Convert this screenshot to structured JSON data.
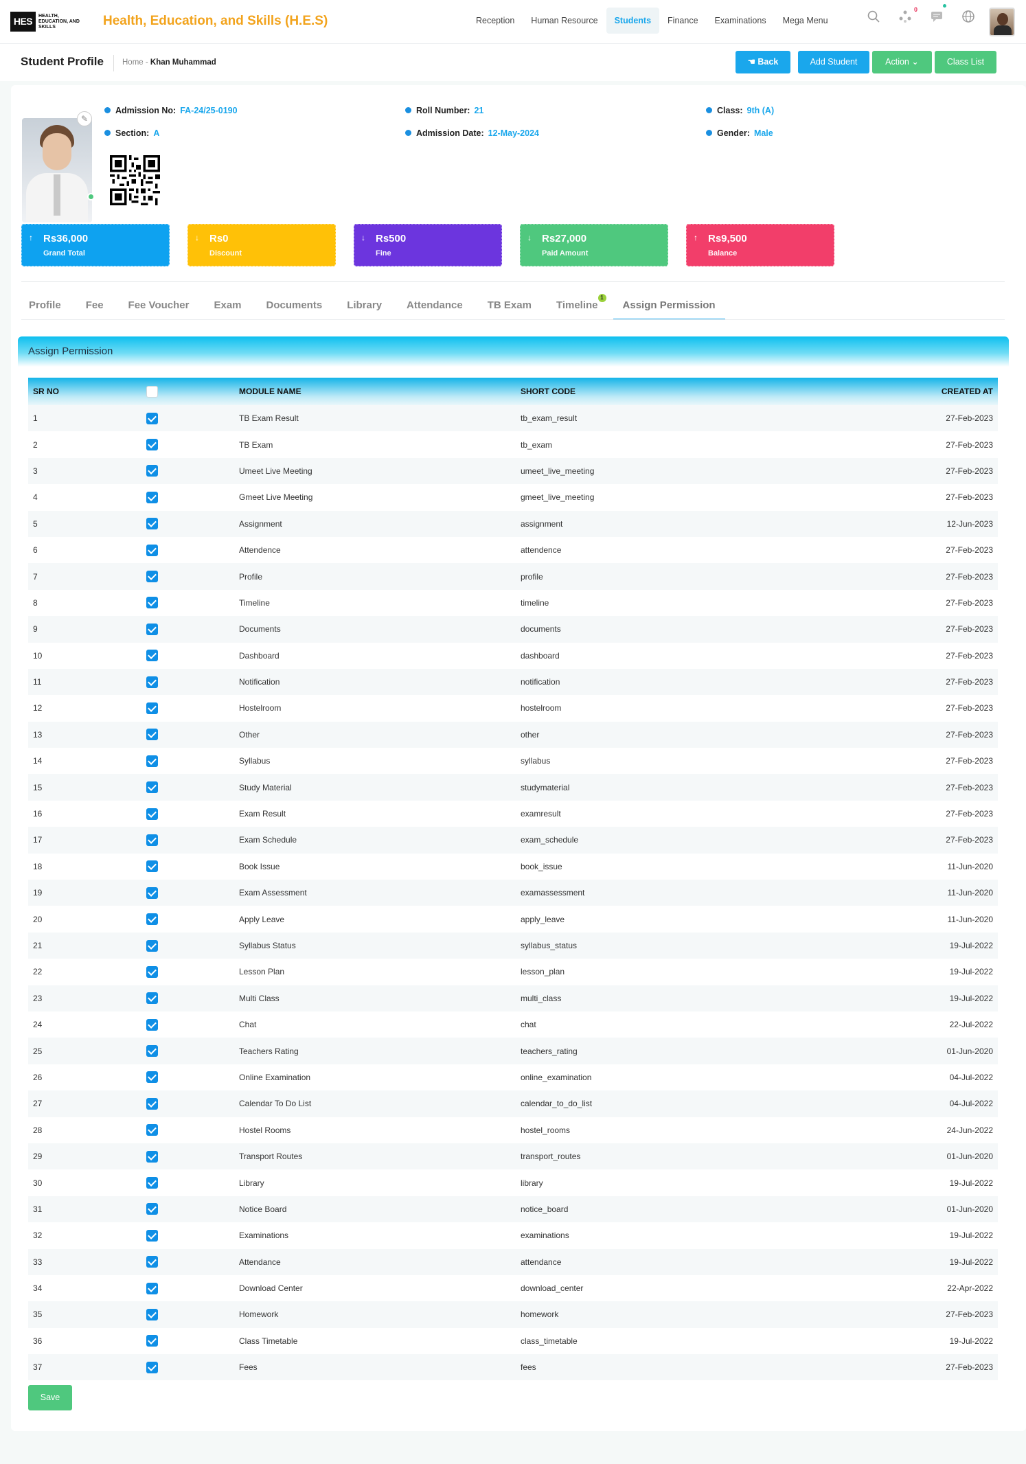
{
  "header": {
    "logo_text": "HES",
    "logo_sub": "HEALTH, EDUCATION, AND SKILLS",
    "brand": "Health, Education, and Skills (H.E.S)",
    "nav": [
      "Reception",
      "Human Resource",
      "Students",
      "Finance",
      "Examinations",
      "Mega Menu"
    ],
    "active_nav": "Students",
    "notification_count": "0",
    "icons": [
      "search-icon",
      "network-icon",
      "chat-icon",
      "globe-icon"
    ]
  },
  "subheader": {
    "title": "Student Profile",
    "breadcrumb_home": "Home",
    "breadcrumb_current": "Khan Muhammad",
    "back_label": "Back",
    "add_student_label": "Add Student",
    "action_label": "Action",
    "class_list_label": "Class List"
  },
  "student": {
    "admission_no_label": "Admission No:",
    "admission_no": "FA-24/25-0190",
    "roll_label": "Roll Number:",
    "roll": "21",
    "class_label": "Class:",
    "class": "9th (A)",
    "section_label": "Section:",
    "section": "A",
    "admission_date_label": "Admission Date:",
    "admission_date": "12-May-2024",
    "gender_label": "Gender:",
    "gender": "Male"
  },
  "stats": [
    {
      "amount": "Rs36,000",
      "label": "Grand Total",
      "color": "#0ea2f0",
      "arrow": "up"
    },
    {
      "amount": "Rs0",
      "label": "Discount",
      "color": "#ffc107",
      "arrow": "down"
    },
    {
      "amount": "Rs500",
      "label": "Fine",
      "color": "#6c35de",
      "arrow": "down"
    },
    {
      "amount": "Rs27,000",
      "label": "Paid Amount",
      "color": "#4fc87e",
      "arrow": "down"
    },
    {
      "amount": "Rs9,500",
      "label": "Balance",
      "color": "#f23e6a",
      "arrow": "up"
    }
  ],
  "tabs": [
    "Profile",
    "Fee",
    "Fee Voucher",
    "Exam",
    "Documents",
    "Library",
    "Attendance",
    "TB Exam",
    "Timeline",
    "Assign Permission"
  ],
  "timeline_badge": "1",
  "active_tab": "Assign Permission",
  "panel": {
    "title": "Assign Permission",
    "save_label": "Save",
    "headers": [
      "SR NO",
      "",
      "MODULE NAME",
      "SHORT CODE",
      "CREATED AT"
    ]
  },
  "rows": [
    [
      "1",
      "TB Exam Result",
      "tb_exam_result",
      "27-Feb-2023"
    ],
    [
      "2",
      "TB Exam",
      "tb_exam",
      "27-Feb-2023"
    ],
    [
      "3",
      "Umeet Live Meeting",
      "umeet_live_meeting",
      "27-Feb-2023"
    ],
    [
      "4",
      "Gmeet Live Meeting",
      "gmeet_live_meeting",
      "27-Feb-2023"
    ],
    [
      "5",
      "Assignment",
      "assignment",
      "12-Jun-2023"
    ],
    [
      "6",
      "Attendence",
      "attendence",
      "27-Feb-2023"
    ],
    [
      "7",
      "Profile",
      "profile",
      "27-Feb-2023"
    ],
    [
      "8",
      "Timeline",
      "timeline",
      "27-Feb-2023"
    ],
    [
      "9",
      "Documents",
      "documents",
      "27-Feb-2023"
    ],
    [
      "10",
      "Dashboard",
      "dashboard",
      "27-Feb-2023"
    ],
    [
      "11",
      "Notification",
      "notification",
      "27-Feb-2023"
    ],
    [
      "12",
      "Hostelroom",
      "hostelroom",
      "27-Feb-2023"
    ],
    [
      "13",
      "Other",
      "other",
      "27-Feb-2023"
    ],
    [
      "14",
      "Syllabus",
      "syllabus",
      "27-Feb-2023"
    ],
    [
      "15",
      "Study Material",
      "studymaterial",
      "27-Feb-2023"
    ],
    [
      "16",
      "Exam Result",
      "examresult",
      "27-Feb-2023"
    ],
    [
      "17",
      "Exam Schedule",
      "exam_schedule",
      "27-Feb-2023"
    ],
    [
      "18",
      "Book Issue",
      "book_issue",
      "11-Jun-2020"
    ],
    [
      "19",
      "Exam Assessment",
      "examassessment",
      "11-Jun-2020"
    ],
    [
      "20",
      "Apply Leave",
      "apply_leave",
      "11-Jun-2020"
    ],
    [
      "21",
      "Syllabus Status",
      "syllabus_status",
      "19-Jul-2022"
    ],
    [
      "22",
      "Lesson Plan",
      "lesson_plan",
      "19-Jul-2022"
    ],
    [
      "23",
      "Multi Class",
      "multi_class",
      "19-Jul-2022"
    ],
    [
      "24",
      "Chat",
      "chat",
      "22-Jul-2022"
    ],
    [
      "25",
      "Teachers Rating",
      "teachers_rating",
      "01-Jun-2020"
    ],
    [
      "26",
      "Online Examination",
      "online_examination",
      "04-Jul-2022"
    ],
    [
      "27",
      "Calendar To Do List",
      "calendar_to_do_list",
      "04-Jul-2022"
    ],
    [
      "28",
      "Hostel Rooms",
      "hostel_rooms",
      "24-Jun-2022"
    ],
    [
      "29",
      "Transport Routes",
      "transport_routes",
      "01-Jun-2020"
    ],
    [
      "30",
      "Library",
      "library",
      "19-Jul-2022"
    ],
    [
      "31",
      "Notice Board",
      "notice_board",
      "01-Jun-2020"
    ],
    [
      "32",
      "Examinations",
      "examinations",
      "19-Jul-2022"
    ],
    [
      "33",
      "Attendance",
      "attendance",
      "19-Jul-2022"
    ],
    [
      "34",
      "Download Center",
      "download_center",
      "22-Apr-2022"
    ],
    [
      "35",
      "Homework",
      "homework",
      "27-Feb-2023"
    ],
    [
      "36",
      "Class Timetable",
      "class_timetable",
      "19-Jul-2022"
    ],
    [
      "37",
      "Fees",
      "fees",
      "27-Feb-2023"
    ]
  ]
}
